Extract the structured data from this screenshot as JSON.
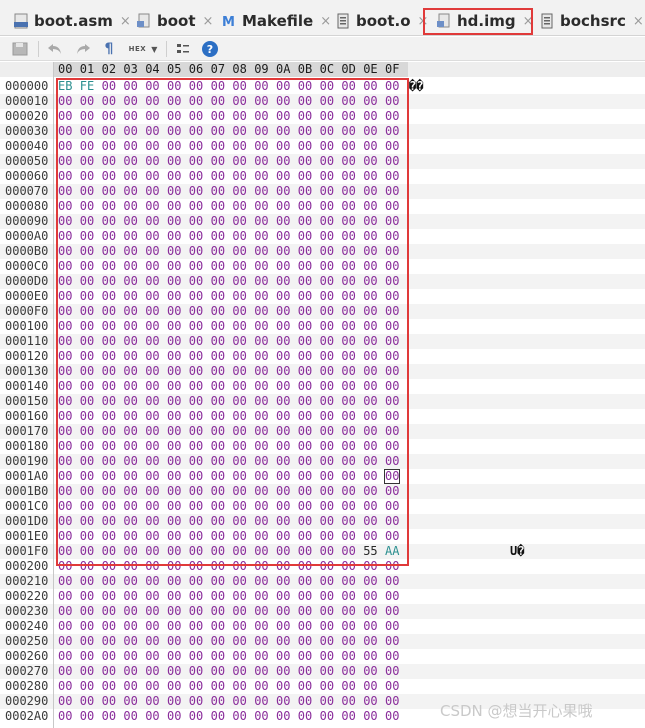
{
  "tabs": [
    {
      "label": "boot.asm",
      "icon": "asm-file-icon"
    },
    {
      "label": "boot",
      "icon": "binary-file-icon"
    },
    {
      "label": "Makefile",
      "icon": "makefile-icon"
    },
    {
      "label": "boot.o",
      "icon": "object-file-icon"
    },
    {
      "label": "hd.img",
      "icon": "binary-file-icon",
      "active": true
    },
    {
      "label": "bochsrc",
      "icon": "text-file-icon"
    }
  ],
  "tab_close_glyph": "×",
  "toolbar": {
    "hex_label": "HEX",
    "help_label": "?"
  },
  "hex": {
    "columns": [
      "00",
      "01",
      "02",
      "03",
      "04",
      "05",
      "06",
      "07",
      "08",
      "09",
      "0A",
      "0B",
      "0C",
      "0D",
      "0E",
      "0F"
    ],
    "rows": [
      {
        "offset": "000000",
        "bytes": [
          "EB",
          "FE",
          "00",
          "00",
          "00",
          "00",
          "00",
          "00",
          "00",
          "00",
          "00",
          "00",
          "00",
          "00",
          "00",
          "00"
        ],
        "ascii": "��"
      },
      {
        "offset": "000010"
      },
      {
        "offset": "000020"
      },
      {
        "offset": "000030"
      },
      {
        "offset": "000040"
      },
      {
        "offset": "000050"
      },
      {
        "offset": "000060"
      },
      {
        "offset": "000070"
      },
      {
        "offset": "000080"
      },
      {
        "offset": "000090"
      },
      {
        "offset": "0000A0"
      },
      {
        "offset": "0000B0"
      },
      {
        "offset": "0000C0"
      },
      {
        "offset": "0000D0"
      },
      {
        "offset": "0000E0"
      },
      {
        "offset": "0000F0"
      },
      {
        "offset": "000100"
      },
      {
        "offset": "000110"
      },
      {
        "offset": "000120"
      },
      {
        "offset": "000130"
      },
      {
        "offset": "000140"
      },
      {
        "offset": "000150"
      },
      {
        "offset": "000160"
      },
      {
        "offset": "000170"
      },
      {
        "offset": "000180"
      },
      {
        "offset": "000190"
      },
      {
        "offset": "0001A0",
        "cursor_col": 15
      },
      {
        "offset": "0001B0"
      },
      {
        "offset": "0001C0"
      },
      {
        "offset": "0001D0"
      },
      {
        "offset": "0001E0"
      },
      {
        "offset": "0001F0",
        "bytes": [
          "00",
          "00",
          "00",
          "00",
          "00",
          "00",
          "00",
          "00",
          "00",
          "00",
          "00",
          "00",
          "00",
          "00",
          "55",
          "AA"
        ],
        "ascii": "U�"
      },
      {
        "offset": "000200"
      },
      {
        "offset": "000210"
      },
      {
        "offset": "000220"
      },
      {
        "offset": "000230"
      },
      {
        "offset": "000240"
      },
      {
        "offset": "000250"
      },
      {
        "offset": "000260"
      },
      {
        "offset": "000270"
      },
      {
        "offset": "000280"
      },
      {
        "offset": "000290"
      },
      {
        "offset": "0002A0"
      }
    ],
    "default_byte": "00"
  },
  "colors": {
    "byte_zero": "#8a2c9b",
    "byte_nonzero": "#2b8f8f",
    "highlight_border": "#e03a3a"
  },
  "watermark": "CSDN @想当开心果哦"
}
